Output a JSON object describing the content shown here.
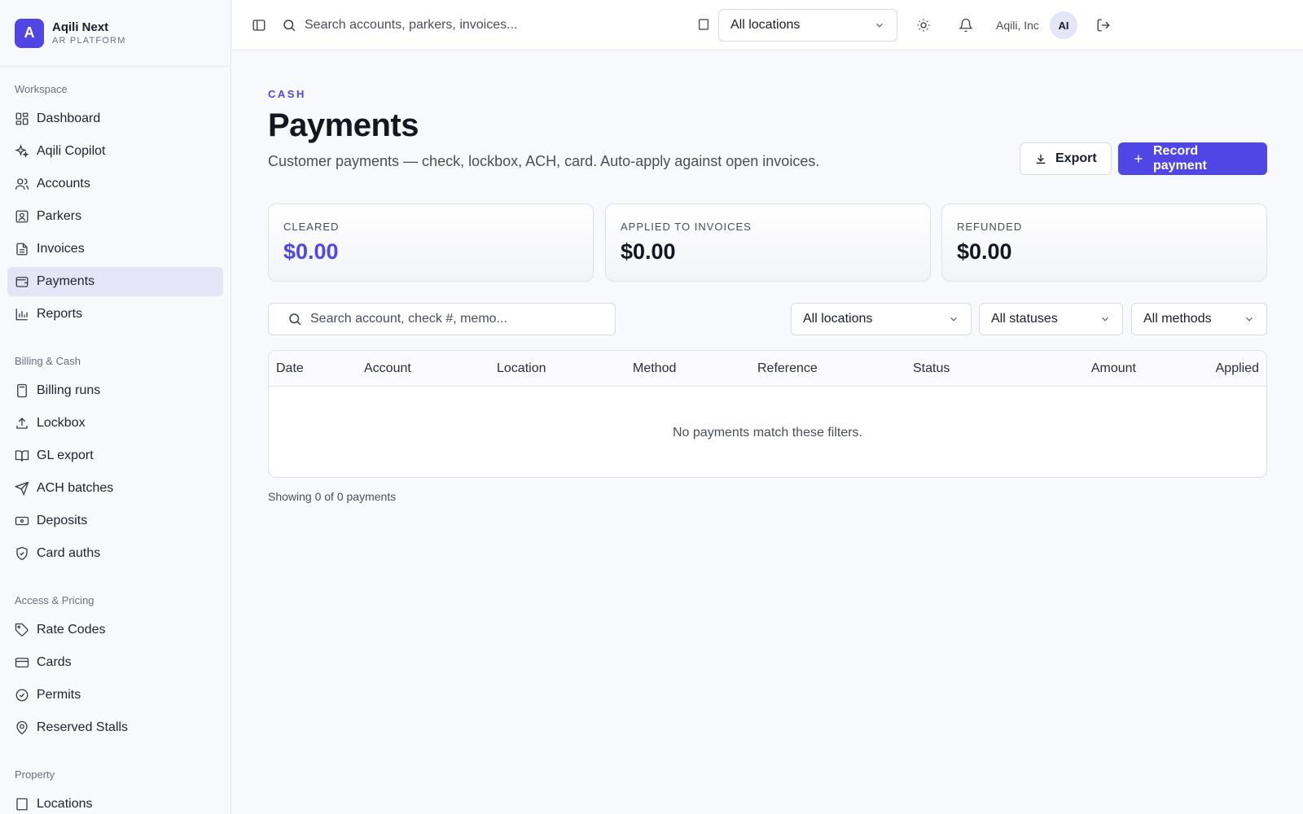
{
  "brand": {
    "logo_letter": "A",
    "name": "Aqili Next",
    "subtitle": "AR PLATFORM"
  },
  "sidebar": {
    "sections": [
      {
        "heading": "Workspace",
        "items": [
          {
            "label": "Dashboard",
            "icon": "dashboard-icon"
          },
          {
            "label": "Aqili Copilot",
            "icon": "sparkles-icon"
          },
          {
            "label": "Accounts",
            "icon": "users-icon"
          },
          {
            "label": "Parkers",
            "icon": "contact-icon"
          },
          {
            "label": "Invoices",
            "icon": "file-text-icon"
          },
          {
            "label": "Payments",
            "icon": "wallet-icon",
            "active": true
          },
          {
            "label": "Reports",
            "icon": "bar-chart-icon"
          }
        ]
      },
      {
        "heading": "Billing & Cash",
        "items": [
          {
            "label": "Billing runs",
            "icon": "calculator-icon"
          },
          {
            "label": "Lockbox",
            "icon": "upload-icon"
          },
          {
            "label": "GL export",
            "icon": "book-icon"
          },
          {
            "label": "ACH batches",
            "icon": "send-icon"
          },
          {
            "label": "Deposits",
            "icon": "banknote-icon"
          },
          {
            "label": "Card auths",
            "icon": "shield-icon"
          }
        ]
      },
      {
        "heading": "Access & Pricing",
        "items": [
          {
            "label": "Rate Codes",
            "icon": "tag-icon"
          },
          {
            "label": "Cards",
            "icon": "credit-card-icon"
          },
          {
            "label": "Permits",
            "icon": "badge-check-icon"
          },
          {
            "label": "Reserved Stalls",
            "icon": "map-pin-icon"
          }
        ]
      },
      {
        "heading": "Property",
        "items": [
          {
            "label": "Locations",
            "icon": "building-icon"
          }
        ]
      }
    ]
  },
  "topbar": {
    "search_placeholder": "Search accounts, parkers, invoices...",
    "location_select": "All locations",
    "org_name": "Aqili, Inc",
    "avatar_initials": "AI"
  },
  "page": {
    "eyebrow": "CASH",
    "title": "Payments",
    "subtitle": "Customer payments — check, lockbox, ACH, card. Auto-apply against open invoices.",
    "export_label": "Export",
    "record_label": "Record payment"
  },
  "stats": [
    {
      "label": "CLEARED",
      "value": "$0.00",
      "accent": true
    },
    {
      "label": "APPLIED TO INVOICES",
      "value": "$0.00"
    },
    {
      "label": "REFUNDED",
      "value": "$0.00"
    }
  ],
  "filters": {
    "search_placeholder": "Search account, check #, memo...",
    "location": "All locations",
    "status": "All statuses",
    "method": "All methods"
  },
  "table": {
    "columns": [
      "Date",
      "Account",
      "Location",
      "Method",
      "Reference",
      "Status",
      "Amount",
      "Applied"
    ],
    "empty_message": "No payments match these filters."
  },
  "footer": {
    "count_text": "Showing 0 of 0 payments"
  },
  "colors": {
    "accent": "#4f46e5",
    "active_nav_bg": "#e4e5f7"
  }
}
